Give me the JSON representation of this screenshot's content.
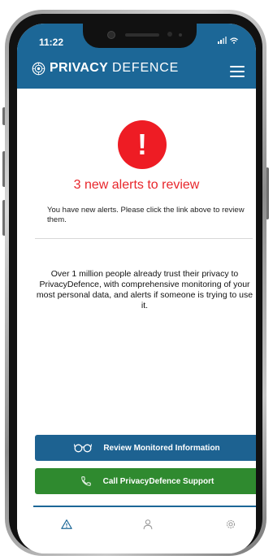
{
  "status_bar": {
    "time": "11:22"
  },
  "header": {
    "brand_primary": "PRIVACY",
    "brand_secondary": "DEFENCE",
    "logo_icon": "eye-logo-icon",
    "menu_icon": "hamburger-menu-icon"
  },
  "alert": {
    "icon": "exclamation-icon",
    "heading": "3 new alerts to review",
    "text": "You have new alerts.  Please click the link above to review them."
  },
  "trust_text": "Over 1 million people already trust their privacy to PrivacyDefence, with comprehensive monitoring of your most personal data, and alerts if someone is trying to use it.",
  "buttons": {
    "review_label": "Review Monitored Information",
    "review_icon": "glasses-icon",
    "call_label": "Call PrivacyDefence Support",
    "call_icon": "phone-icon"
  },
  "tabbar": {
    "items": [
      "alerts-warning-icon",
      "profile-icon",
      "settings-gear-icon"
    ]
  },
  "colors": {
    "header": "#1c6797",
    "alert_red": "#ee1c24",
    "review_button": "#1d6291",
    "call_button": "#2f8a2f"
  }
}
